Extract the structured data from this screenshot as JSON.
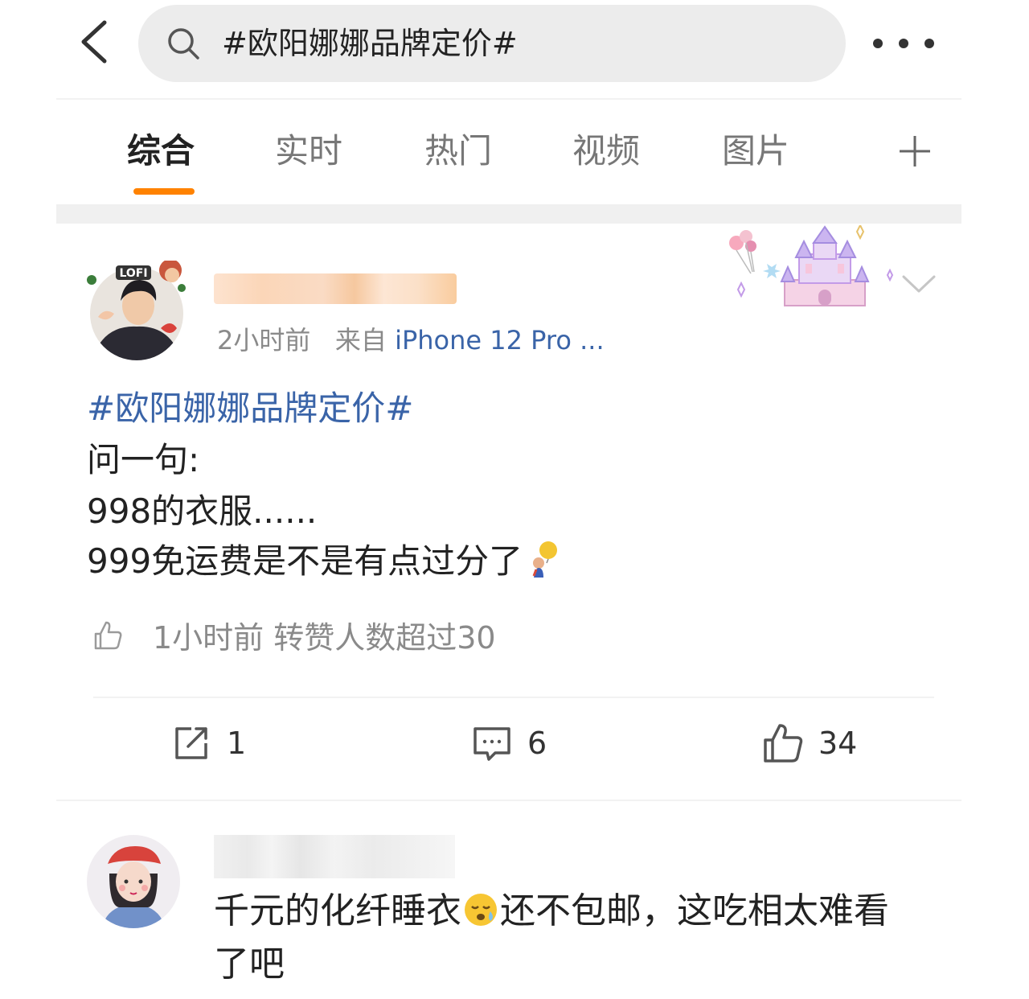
{
  "search": {
    "query": "#欧阳娜娜品牌定价#"
  },
  "tabs": [
    "综合",
    "实时",
    "热门",
    "视频",
    "图片"
  ],
  "active_tab": "综合",
  "colors": {
    "accent": "#ff8200",
    "link": "#3a64a8",
    "meta": "#8a8a8a"
  },
  "post": {
    "time": "2小时前",
    "source_prefix": "来自",
    "source": "iPhone 12 Pro ...",
    "hashtag": "#欧阳娜娜品牌定价#",
    "lines": [
      "问一句:",
      "998的衣服......",
      "999免运费是不是有点过分了"
    ],
    "note": "1小时前 转赞人数超过30",
    "reposts": "1",
    "comments": "6",
    "likes": "34"
  },
  "comment": {
    "text_part1": "千元的化纤睡衣",
    "text_part2": "还不包邮，这吃相太难看",
    "line2": "了吧"
  }
}
